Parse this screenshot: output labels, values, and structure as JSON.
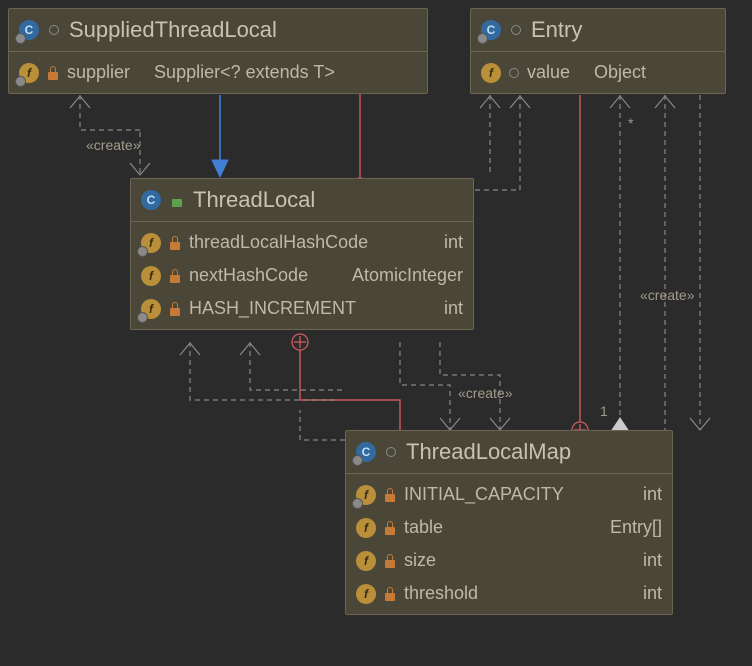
{
  "classes": {
    "suppliedThreadLocal": {
      "name": "SuppliedThreadLocal",
      "fields": [
        {
          "name": "supplier",
          "type": "Supplier<? extends T>",
          "vis": "private"
        }
      ]
    },
    "entry": {
      "name": "Entry",
      "fields": [
        {
          "name": "value",
          "type": "Object",
          "vis": "package"
        }
      ]
    },
    "threadLocal": {
      "name": "ThreadLocal",
      "fields": [
        {
          "name": "threadLocalHashCode",
          "type": "int",
          "vis": "private"
        },
        {
          "name": "nextHashCode",
          "type": "AtomicInteger",
          "vis": "private"
        },
        {
          "name": "HASH_INCREMENT",
          "type": "int",
          "vis": "private"
        }
      ]
    },
    "threadLocalMap": {
      "name": "ThreadLocalMap",
      "fields": [
        {
          "name": "INITIAL_CAPACITY",
          "type": "int",
          "vis": "private"
        },
        {
          "name": "table",
          "type": "Entry[]",
          "vis": "private"
        },
        {
          "name": "size",
          "type": "int",
          "vis": "private"
        },
        {
          "name": "threshold",
          "type": "int",
          "vis": "private"
        }
      ]
    }
  },
  "labels": {
    "create": "«create»",
    "star": "*",
    "one": "1"
  }
}
